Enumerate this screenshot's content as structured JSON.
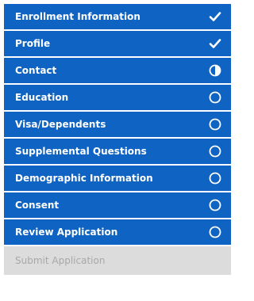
{
  "steps": [
    {
      "label": "Enrollment Information",
      "status": "complete",
      "icon": "check-icon"
    },
    {
      "label": "Profile",
      "status": "complete",
      "icon": "check-icon"
    },
    {
      "label": "Contact",
      "status": "in-progress",
      "icon": "half-circle-icon"
    },
    {
      "label": "Education",
      "status": "incomplete",
      "icon": "empty-circle-icon"
    },
    {
      "label": "Visa/Dependents",
      "status": "incomplete",
      "icon": "empty-circle-icon"
    },
    {
      "label": "Supplemental Questions",
      "status": "incomplete",
      "icon": "empty-circle-icon"
    },
    {
      "label": "Demographic Information",
      "status": "incomplete",
      "icon": "empty-circle-icon"
    },
    {
      "label": "Consent",
      "status": "incomplete",
      "icon": "empty-circle-icon"
    },
    {
      "label": "Review Application",
      "status": "incomplete",
      "icon": "empty-circle-icon"
    },
    {
      "label": "Submit Application",
      "status": "disabled",
      "icon": ""
    }
  ],
  "colors": {
    "active_bg": "#0f63c2",
    "disabled_bg": "#dcdcdc",
    "disabled_text": "#a8a8a8"
  }
}
